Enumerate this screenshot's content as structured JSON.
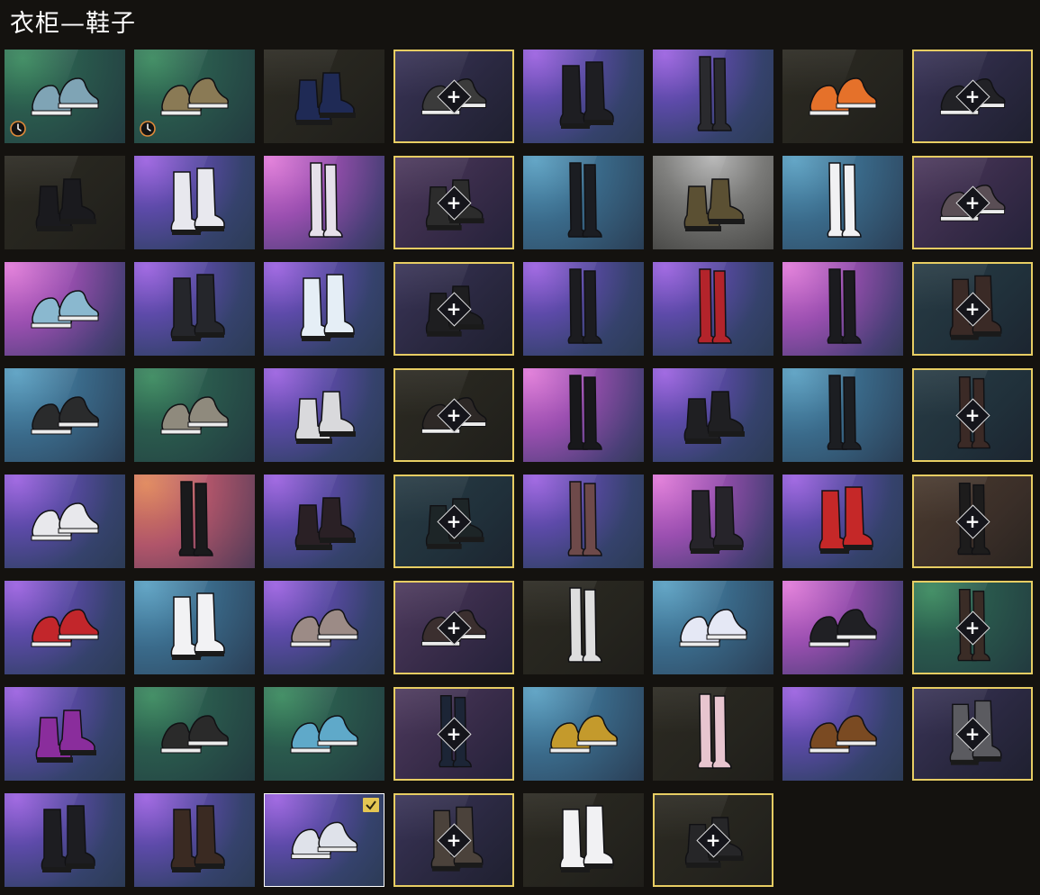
{
  "title": "衣柜—鞋子",
  "colors": {
    "locked_border": "#e7cd63",
    "selected_border": "#ffffff",
    "check_badge": "#e4c653"
  },
  "tiles": [
    {
      "name": "blue-high-top-sneakers",
      "state": "owned",
      "bg": "green",
      "shoe": "sneaker",
      "tint": "#7fa4b5",
      "clock": true
    },
    {
      "name": "camo-sneakers",
      "state": "owned",
      "bg": "green",
      "shoe": "sneaker",
      "tint": "#8a7a55",
      "clock": true
    },
    {
      "name": "starry-rain-boots",
      "state": "owned",
      "bg": "dark",
      "shoe": "boot",
      "tint": "#1f2a55"
    },
    {
      "name": "dark-sandals-locked",
      "state": "locked",
      "bg": "navy",
      "shoe": "sneaker",
      "tint": "#3b3b3b"
    },
    {
      "name": "black-tall-boots",
      "state": "owned",
      "bg": "purple",
      "shoe": "tallboot",
      "tint": "#1e1e22"
    },
    {
      "name": "black-bodysuit-boots",
      "state": "owned",
      "bg": "purple",
      "shoe": "thigh",
      "tint": "#2a2a2e"
    },
    {
      "name": "orange-white-sneakers",
      "state": "owned",
      "bg": "dark",
      "shoe": "sneaker",
      "tint": "#e5712a"
    },
    {
      "name": "black-shoes-locked",
      "state": "locked",
      "bg": "navy",
      "shoe": "sneaker",
      "tint": "#222226"
    },
    {
      "name": "black-combat-boots",
      "state": "owned",
      "bg": "dark",
      "shoe": "boot",
      "tint": "#1a1a1e"
    },
    {
      "name": "white-red-boots",
      "state": "owned",
      "bg": "purple",
      "shoe": "tallboot",
      "tint": "#e8e8ee"
    },
    {
      "name": "white-ballet-boots",
      "state": "owned",
      "bg": "pink",
      "shoe": "thigh",
      "tint": "#e6e0ea"
    },
    {
      "name": "black-gaiter-boots-locked",
      "state": "locked",
      "bg": "violet",
      "shoe": "boot",
      "tint": "#2c2c2c"
    },
    {
      "name": "black-leggings-boots",
      "state": "owned",
      "bg": "teal",
      "shoe": "thigh",
      "tint": "#1b1d22"
    },
    {
      "name": "brown-military-boots",
      "state": "owned",
      "bg": "grey",
      "shoe": "boot",
      "tint": "#5b5033"
    },
    {
      "name": "white-stockings",
      "state": "owned",
      "bg": "teal",
      "shoe": "thigh",
      "tint": "#f1f1f3"
    },
    {
      "name": "grey-slippers-locked",
      "state": "locked",
      "bg": "violet",
      "shoe": "sneaker",
      "tint": "#5a4e55"
    },
    {
      "name": "shark-slippers",
      "state": "owned",
      "bg": "pink",
      "shoe": "sneaker",
      "tint": "#8ab8cf"
    },
    {
      "name": "black-fur-boots",
      "state": "owned",
      "bg": "purple",
      "shoe": "tallboot",
      "tint": "#25262b"
    },
    {
      "name": "white-fur-boots",
      "state": "owned",
      "bg": "purple",
      "shoe": "tallboot",
      "tint": "#e5eef6"
    },
    {
      "name": "black-boots-locked",
      "state": "locked",
      "bg": "navy",
      "shoe": "boot",
      "tint": "#1e1e20"
    },
    {
      "name": "black-thigh-boots",
      "state": "owned",
      "bg": "purple",
      "shoe": "thigh",
      "tint": "#1c1c20"
    },
    {
      "name": "red-racing-leggings",
      "state": "owned",
      "bg": "purple",
      "shoe": "thigh",
      "tint": "#b3242b"
    },
    {
      "name": "black-heel-thigh-boots",
      "state": "owned",
      "bg": "pink",
      "shoe": "thigh",
      "tint": "#1b1b1f"
    },
    {
      "name": "brown-armor-boots-locked",
      "state": "locked",
      "bg": "darkteal",
      "shoe": "tallboot",
      "tint": "#3a2a26"
    },
    {
      "name": "yellow-black-sneakers",
      "state": "owned",
      "bg": "teal",
      "shoe": "sneaker",
      "tint": "#2a2b2c"
    },
    {
      "name": "grey-slip-ons",
      "state": "owned",
      "bg": "green",
      "shoe": "sneaker",
      "tint": "#8f8a7d"
    },
    {
      "name": "white-platform-boots",
      "state": "owned",
      "bg": "purple",
      "shoe": "boot",
      "tint": "#d9d9dc"
    },
    {
      "name": "dark-loafers-locked",
      "state": "locked",
      "bg": "dark",
      "shoe": "sneaker",
      "tint": "#2d2826"
    },
    {
      "name": "black-over-knee-boots",
      "state": "owned",
      "bg": "pink",
      "shoe": "thigh",
      "tint": "#18181b"
    },
    {
      "name": "black-red-hightops",
      "state": "owned",
      "bg": "purple",
      "shoe": "boot",
      "tint": "#1f1f22"
    },
    {
      "name": "black-tactical-pants",
      "state": "owned",
      "bg": "teal",
      "shoe": "thigh",
      "tint": "#1c1e22"
    },
    {
      "name": "rust-pants-locked",
      "state": "locked",
      "bg": "darkteal",
      "shoe": "thigh",
      "tint": "#3b2a26"
    },
    {
      "name": "white-low-sneakers",
      "state": "owned",
      "bg": "purple",
      "shoe": "sneaker",
      "tint": "#e8e8ec"
    },
    {
      "name": "black-thigh-high-heels",
      "state": "owned",
      "bg": "sunset",
      "shoe": "thigh",
      "tint": "#1a1a1c"
    },
    {
      "name": "black-pink-lace-boots",
      "state": "owned",
      "bg": "purple",
      "shoe": "boot",
      "tint": "#2a2025"
    },
    {
      "name": "teal-sole-boots-locked",
      "state": "locked",
      "bg": "darkteal",
      "shoe": "boot",
      "tint": "#1d2527"
    },
    {
      "name": "brown-pink-stockings",
      "state": "owned",
      "bg": "purple",
      "shoe": "thigh",
      "tint": "#6e4a4a"
    },
    {
      "name": "pink-strap-boots",
      "state": "owned",
      "bg": "pink",
      "shoe": "tallboot",
      "tint": "#26242a"
    },
    {
      "name": "ducati-racing-boots",
      "state": "owned",
      "bg": "purple",
      "shoe": "tallboot",
      "tint": "#c52828"
    },
    {
      "name": "dark-wrapped-boots-locked",
      "state": "locked",
      "bg": "brown",
      "shoe": "thigh",
      "tint": "#1d1c1c"
    },
    {
      "name": "red-high-top-sneakers",
      "state": "owned",
      "bg": "purple",
      "shoe": "sneaker",
      "tint": "#c2262b"
    },
    {
      "name": "white-bow-socks",
      "state": "owned",
      "bg": "teal",
      "shoe": "tallboot",
      "tint": "#f2f2f4"
    },
    {
      "name": "bunny-sneakers",
      "state": "owned",
      "bg": "purple",
      "shoe": "sneaker",
      "tint": "#9c8b86"
    },
    {
      "name": "dark-sandals-locked-2",
      "state": "locked",
      "bg": "violet",
      "shoe": "sneaker",
      "tint": "#3b2f2f"
    },
    {
      "name": "white-thigh-stockings",
      "state": "owned",
      "bg": "dark",
      "shoe": "thigh",
      "tint": "#dedede"
    },
    {
      "name": "white-blue-sneakers",
      "state": "owned",
      "bg": "teal",
      "shoe": "sneaker",
      "tint": "#e5e8f5"
    },
    {
      "name": "black-strap-sandals",
      "state": "owned",
      "bg": "pink",
      "shoe": "sneaker",
      "tint": "#202024"
    },
    {
      "name": "brown-pants-locked",
      "state": "locked",
      "bg": "green",
      "shoe": "thigh",
      "tint": "#3a2c26"
    },
    {
      "name": "purple-ankle-boots",
      "state": "owned",
      "bg": "purple",
      "shoe": "boot",
      "tint": "#8a2d9c"
    },
    {
      "name": "black-grey-socks",
      "state": "owned",
      "bg": "green",
      "shoe": "sneaker",
      "tint": "#2a2a2a"
    },
    {
      "name": "blue-claw-feet",
      "state": "owned",
      "bg": "green",
      "shoe": "sneaker",
      "tint": "#5fa9c9"
    },
    {
      "name": "blue-tall-boots-locked",
      "state": "locked",
      "bg": "violet",
      "shoe": "thigh",
      "tint": "#1c2536"
    },
    {
      "name": "yellow-dress-shoes",
      "state": "owned",
      "bg": "teal",
      "shoe": "sneaker",
      "tint": "#c49a2c"
    },
    {
      "name": "pink-floral-stockings",
      "state": "owned",
      "bg": "dark",
      "shoe": "thigh",
      "tint": "#e7c5cf"
    },
    {
      "name": "brown-paw-feet",
      "state": "owned",
      "bg": "purple",
      "shoe": "sneaker",
      "tint": "#7a4a22"
    },
    {
      "name": "grey-tall-socks-locked",
      "state": "locked",
      "bg": "navy",
      "shoe": "tallboot",
      "tint": "#5b5b60"
    },
    {
      "name": "heart-cowboy-boots",
      "state": "owned",
      "bg": "purple",
      "shoe": "tallboot",
      "tint": "#1d1d21"
    },
    {
      "name": "brown-black-boots",
      "state": "owned",
      "bg": "purple",
      "shoe": "tallboot",
      "tint": "#3a2a22"
    },
    {
      "name": "winged-sneakers",
      "state": "selected",
      "bg": "purple",
      "shoe": "sneaker",
      "tint": "#dfe2ea"
    },
    {
      "name": "fur-lined-boots-locked",
      "state": "locked",
      "bg": "navy",
      "shoe": "tallboot",
      "tint": "#4b423b"
    },
    {
      "name": "white-red-sandals",
      "state": "owned",
      "bg": "dark",
      "shoe": "tallboot",
      "tint": "#f1f1f3"
    },
    {
      "name": "black-boots-locked-2",
      "state": "locked",
      "bg": "dark",
      "shoe": "boot",
      "tint": "#262628"
    }
  ]
}
